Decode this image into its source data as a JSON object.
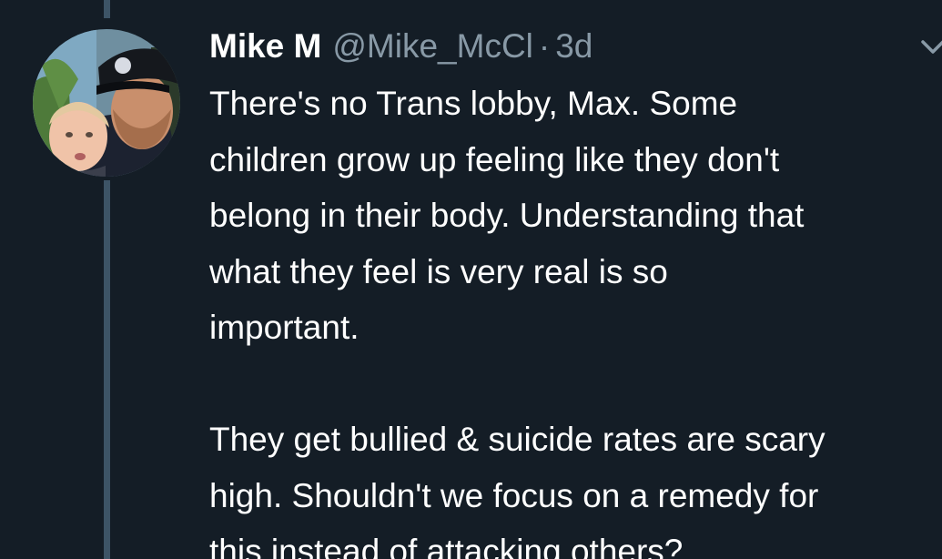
{
  "tweet": {
    "author": {
      "display_name": "Mike M",
      "handle": "@Mike_McCl",
      "avatar": "profile-photo-man-with-child"
    },
    "separator": "·",
    "timestamp": "3d",
    "menu_icon": "chevron-down-icon",
    "paragraphs": [
      "There's no Trans lobby, Max. Some\nchildren grow up feeling like they don't\nbelong in their body. Understanding that\nwhat they feel is very real is so\nimportant.",
      "They get bullied & suicide rates are scary\nhigh. Shouldn't we focus on a remedy for\nthis instead of attacking others?"
    ]
  },
  "colors": {
    "background": "#141d26",
    "thread_line": "#3d5466",
    "secondary_text": "#8899a6",
    "primary_text": "#ffffff"
  }
}
